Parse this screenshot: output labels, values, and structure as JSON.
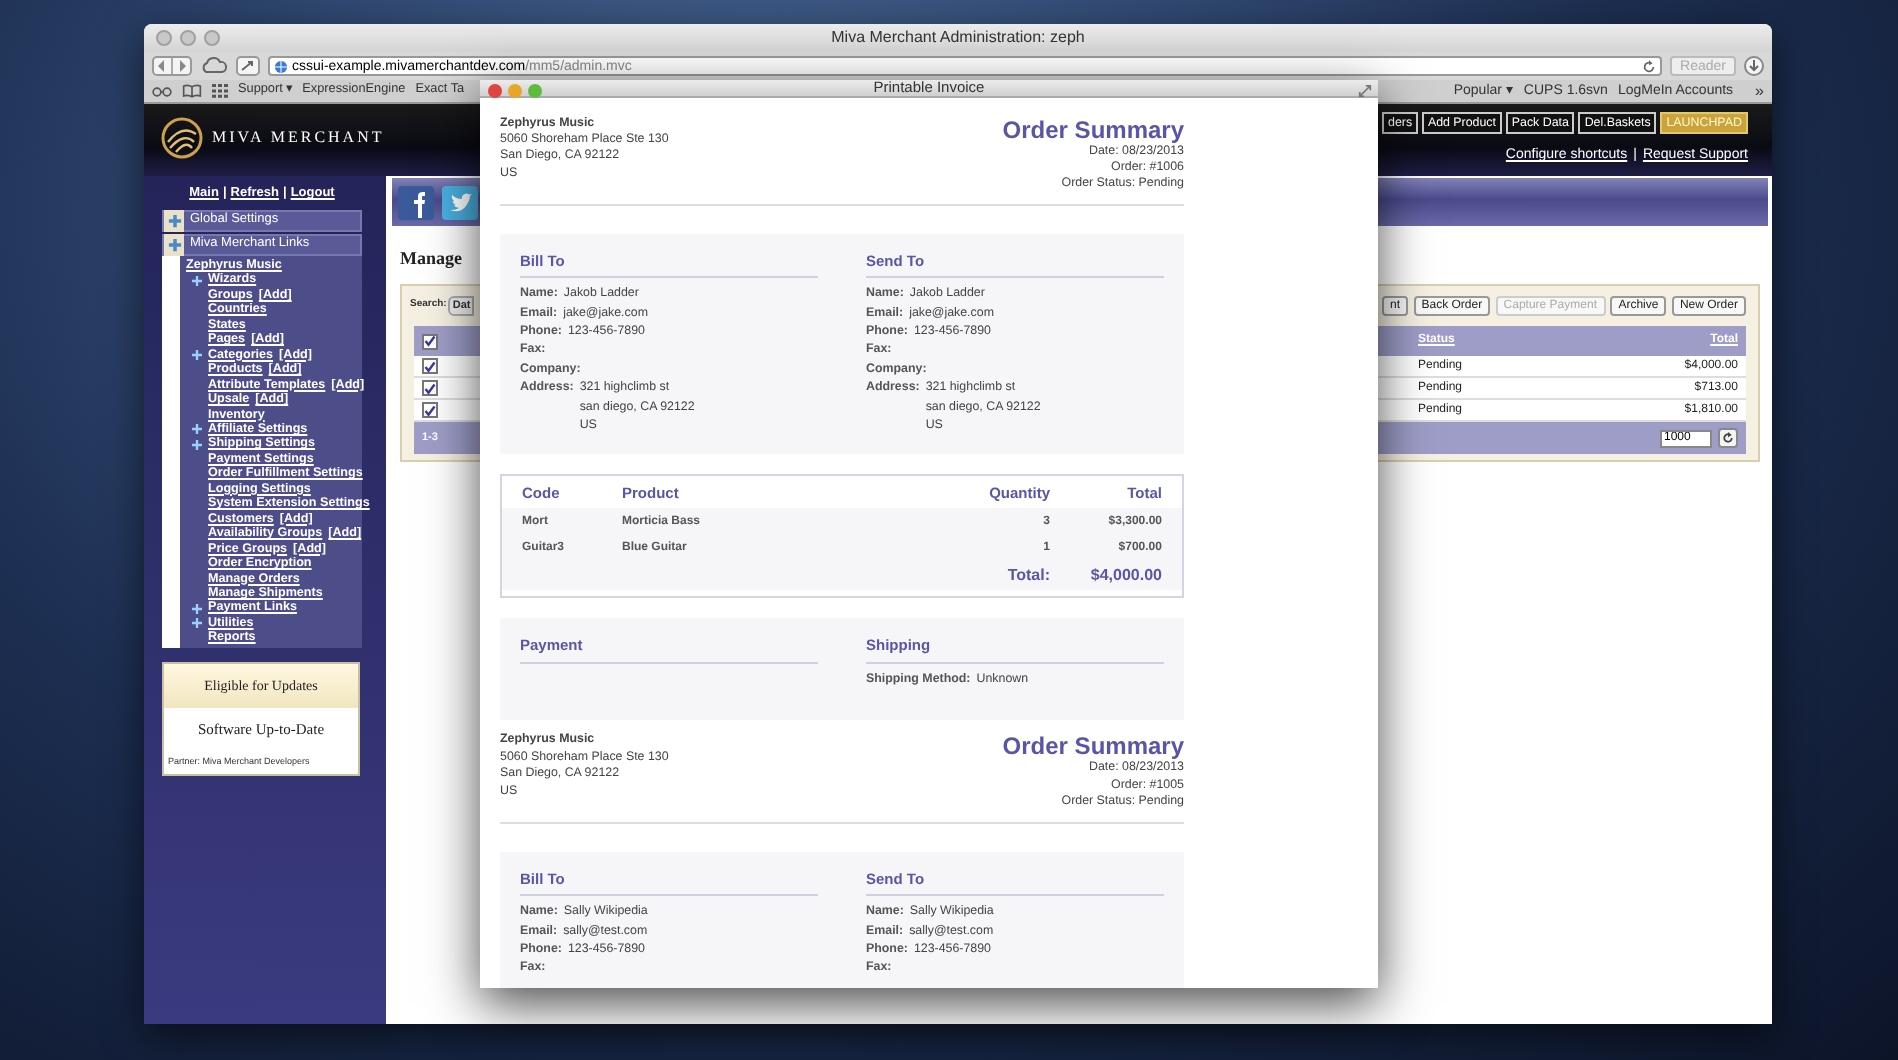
{
  "browser": {
    "title": "Miva Merchant Administration: zeph",
    "url_host": "cssui-example.mivamerchantdev.com",
    "url_path": "/mm5/admin.mvc",
    "reader_button": "Reader",
    "bookmarks_left": [
      {
        "label": "Support ▾"
      },
      {
        "label": "ExpressionEngine"
      },
      {
        "label": "Exact Ta"
      }
    ],
    "bookmarks_right": [
      {
        "label": "Popular ▾"
      },
      {
        "label": "CUPS 1.6svn"
      },
      {
        "label": "LogMeIn Accounts"
      }
    ],
    "bookmarks_more": "»"
  },
  "header": {
    "logo_text": "MIVA MERCHANT",
    "buttons": [
      {
        "label": "ders",
        "kind": "normal"
      },
      {
        "label": "Add Product",
        "kind": "normal"
      },
      {
        "label": "Pack Data",
        "kind": "normal"
      },
      {
        "label": "Del.Baskets",
        "kind": "normal"
      },
      {
        "label": "LAUNCHPAD",
        "kind": "highlight"
      }
    ],
    "links": [
      "Configure shortcuts",
      "Request Support"
    ],
    "link_separator": "|"
  },
  "sidebar": {
    "top_links": [
      "Main",
      "Refresh",
      "Logout"
    ],
    "link_separator": "|",
    "sections": [
      "Global Settings",
      "Miva Merchant Links"
    ],
    "store": {
      "title": "Zephyrus Music",
      "items": [
        {
          "label": "Wizards",
          "expandable": true
        },
        {
          "label": "Groups",
          "add": "[Add]",
          "expandable": false
        },
        {
          "label": "Countries",
          "expandable": false
        },
        {
          "label": "States",
          "expandable": false
        },
        {
          "label": "Pages",
          "add": "[Add]",
          "expandable": false
        },
        {
          "label": "Categories",
          "add": "[Add]",
          "expandable": true
        },
        {
          "label": "Products",
          "add": "[Add]",
          "expandable": false
        },
        {
          "label": "Attribute Templates",
          "add": "[Add]",
          "expandable": false
        },
        {
          "label": "Upsale",
          "add": "[Add]",
          "expandable": false
        },
        {
          "label": "Inventory",
          "expandable": false
        },
        {
          "label": "Affiliate Settings",
          "expandable": true
        },
        {
          "label": "Shipping Settings",
          "expandable": true
        },
        {
          "label": "Payment Settings",
          "expandable": false
        },
        {
          "label": "Order Fulfillment Settings",
          "expandable": false
        },
        {
          "label": "Logging Settings",
          "expandable": false
        },
        {
          "label": "System Extension Settings",
          "expandable": false
        },
        {
          "label": "Customers",
          "add": "[Add]",
          "expandable": false
        },
        {
          "label": "Availability Groups",
          "add": "[Add]",
          "expandable": false
        },
        {
          "label": "Price Groups",
          "add": "[Add]",
          "expandable": false
        },
        {
          "label": "Order Encryption",
          "expandable": false
        },
        {
          "label": "Manage Orders",
          "expandable": false
        },
        {
          "label": "Manage Shipments",
          "expandable": false
        },
        {
          "label": "Payment Links",
          "expandable": true
        },
        {
          "label": "Utilities",
          "expandable": true
        },
        {
          "label": "Reports",
          "expandable": false
        }
      ]
    },
    "updates": {
      "title": "Eligible for Updates",
      "status": "Software Up-to-Date",
      "partner": "Partner: Miva Merchant Developers"
    }
  },
  "main": {
    "page_title": "Manage",
    "search_label": "Search:",
    "search_select": "Dat",
    "buttons": [
      {
        "label": "nt",
        "disabled": false
      },
      {
        "label": "Back Order",
        "disabled": false
      },
      {
        "label": "Capture Payment",
        "disabled": true
      },
      {
        "label": "Archive",
        "disabled": false
      },
      {
        "label": "New Order",
        "disabled": false
      }
    ],
    "table": {
      "header_checked": true,
      "columns": [
        "Status",
        "Total"
      ],
      "rows": [
        {
          "checked": true,
          "status": "Pending",
          "total": "$4,000.00"
        },
        {
          "checked": true,
          "status": "Pending",
          "total": "$713.00"
        },
        {
          "checked": true,
          "status": "Pending",
          "total": "$1,810.00"
        }
      ],
      "range": "1-3",
      "page_size": "1000"
    }
  },
  "invoice": {
    "title": "Printable Invoice",
    "orders": [
      {
        "store": {
          "name": "Zephyrus Music",
          "lines": [
            "5060 Shoreham Place Ste 130",
            "San Diego, CA 92122",
            "US"
          ]
        },
        "title": "Order Summary",
        "meta": [
          "Date: 08/23/2013",
          "Order: #1006",
          "Order Status: Pending"
        ],
        "bill_to": {
          "title": "Bill To",
          "fields": [
            {
              "label": "Name:",
              "lines": [
                "Jakob Ladder"
              ]
            },
            {
              "label": "Email:",
              "lines": [
                "jake@jake.com"
              ]
            },
            {
              "label": "Phone:",
              "lines": [
                "123-456-7890"
              ]
            },
            {
              "label": "Fax:"
            },
            {
              "label": "Company:"
            },
            {
              "label": "Address:",
              "lines": [
                "321 highclimb st",
                "san diego, CA 92122",
                "US"
              ]
            }
          ]
        },
        "send_to": {
          "title": "Send To",
          "fields": [
            {
              "label": "Name:",
              "lines": [
                "Jakob Ladder"
              ]
            },
            {
              "label": "Email:",
              "lines": [
                "jake@jake.com"
              ]
            },
            {
              "label": "Phone:",
              "lines": [
                "123-456-7890"
              ]
            },
            {
              "label": "Fax:"
            },
            {
              "label": "Company:"
            },
            {
              "label": "Address:",
              "lines": [
                "321 highclimb st",
                "san diego, CA 92122",
                "US"
              ]
            }
          ]
        },
        "items": {
          "columns": [
            "Code",
            "Product",
            "Quantity",
            "Total"
          ],
          "rows": [
            {
              "code": "Mort",
              "product": "Morticia Bass",
              "quantity": "3",
              "total": "$3,300.00"
            },
            {
              "code": "Guitar3",
              "product": "Blue Guitar",
              "quantity": "1",
              "total": "$700.00"
            }
          ],
          "total_label": "Total:",
          "total": "$4,000.00"
        },
        "payment": {
          "title": "Payment"
        },
        "shipping": {
          "title": "Shipping",
          "fields": [
            {
              "label": "Shipping Method:",
              "lines": [
                "Unknown"
              ]
            }
          ]
        }
      },
      {
        "store": {
          "name": "Zephyrus Music",
          "lines": [
            "5060 Shoreham Place Ste 130",
            "San Diego, CA 92122",
            "US"
          ]
        },
        "title": "Order Summary",
        "meta": [
          "Date: 08/23/2013",
          "Order: #1005",
          "Order Status: Pending"
        ],
        "bill_to": {
          "title": "Bill To",
          "fields": [
            {
              "label": "Name:",
              "lines": [
                "Sally Wikipedia"
              ]
            },
            {
              "label": "Email:",
              "lines": [
                "sally@test.com"
              ]
            },
            {
              "label": "Phone:",
              "lines": [
                "123-456-7890"
              ]
            },
            {
              "label": "Fax:"
            }
          ]
        },
        "send_to": {
          "title": "Send To",
          "fields": [
            {
              "label": "Name:",
              "lines": [
                "Sally Wikipedia"
              ]
            },
            {
              "label": "Email:",
              "lines": [
                "sally@test.com"
              ]
            },
            {
              "label": "Phone:",
              "lines": [
                "123-456-7890"
              ]
            },
            {
              "label": "Fax:"
            }
          ]
        }
      }
    ]
  }
}
